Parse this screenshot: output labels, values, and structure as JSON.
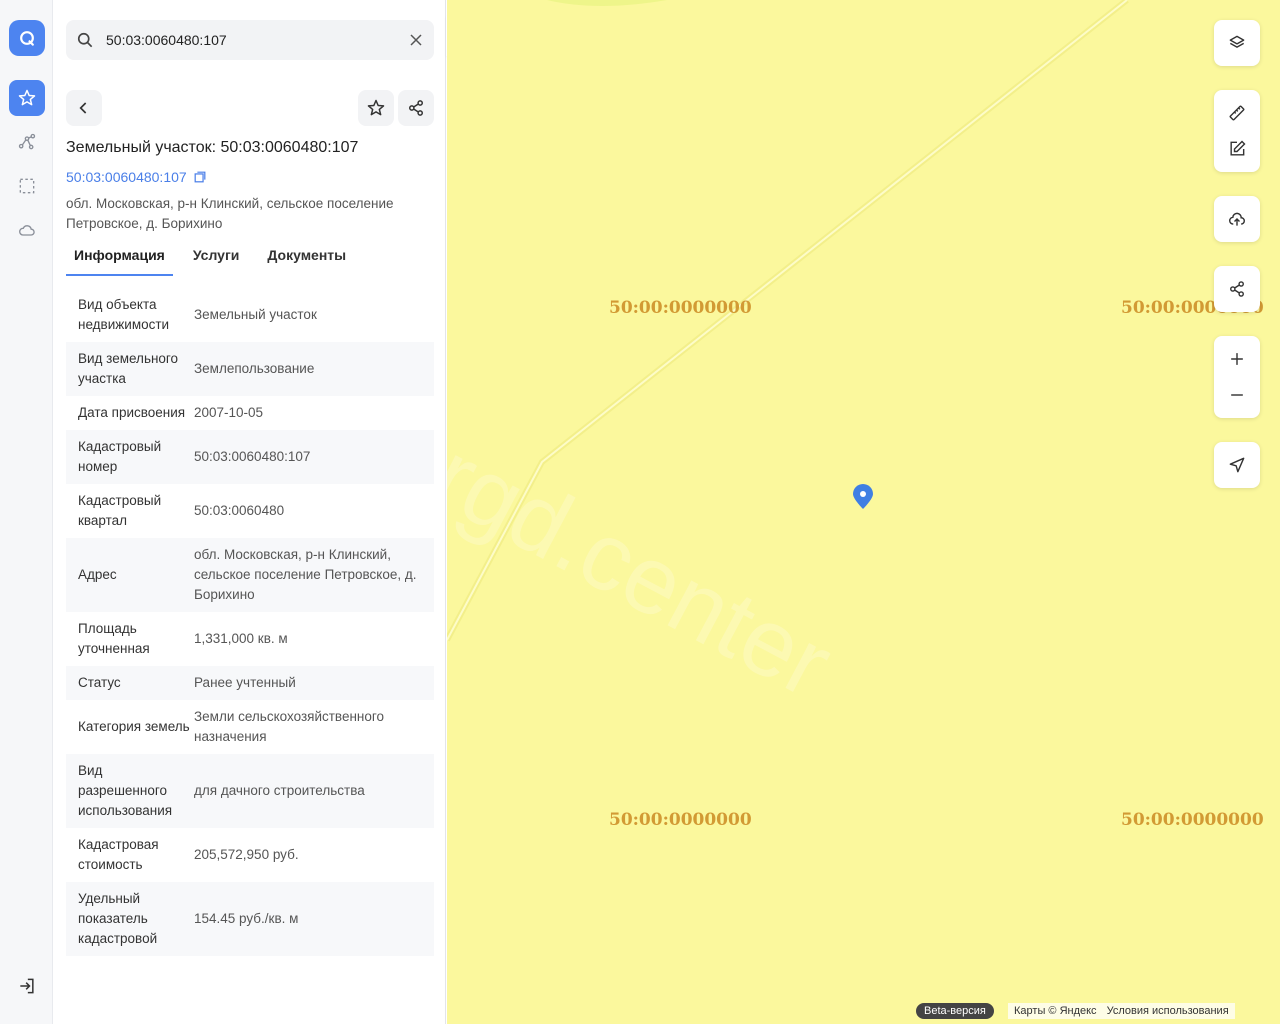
{
  "search": {
    "value": "50:03:0060480:107"
  },
  "panel": {
    "title": "Земельный участок: 50:03:0060480:107",
    "cadastral_link": "50:03:0060480:107",
    "address_line1": "обл. Московская, р-н Клинский, сельское поселение",
    "address_line2": "Петровское, д. Борихино",
    "tabs": [
      {
        "label": "Информация",
        "active": true
      },
      {
        "label": "Услуги",
        "active": false
      },
      {
        "label": "Документы",
        "active": false
      }
    ],
    "rows": [
      {
        "key": "Вид объекта недвижимости",
        "value": "Земельный участок"
      },
      {
        "key": "Вид земельного участка",
        "value": "Землепользование"
      },
      {
        "key": "Дата присвоения",
        "value": "2007-10-05"
      },
      {
        "key": "Кадастровый номер",
        "value": "50:03:0060480:107"
      },
      {
        "key": "Кадастровый квартал",
        "value": "50:03:0060480"
      },
      {
        "key": "Адрес",
        "value": "обл. Московская, р-н Клинский, сельское поселение Петровское, д. Борихино"
      },
      {
        "key": "Площадь уточненная",
        "value": "1,331,000 кв. м"
      },
      {
        "key": "Статус",
        "value": "Ранее учтенный"
      },
      {
        "key": "Категория земель",
        "value": "Земли сельскохозяйственного назначения"
      },
      {
        "key": "Вид разрешенного использования",
        "value": "для дачного строительства"
      },
      {
        "key": "Кадастровая стоимость",
        "value": "205,572,950 руб."
      },
      {
        "key": "Удельный показатель кадастровой",
        "value": "154.45 руб./кв. м"
      }
    ]
  },
  "map": {
    "labels": [
      "50:00:0000000",
      "50:00:0000000",
      "50:00:0000000",
      "50:00:0000000"
    ],
    "watermark": "rgd.center",
    "beta": "Beta-версия",
    "copyright": "Карты © Яндекс",
    "terms": "Условия использования"
  },
  "colors": {
    "accent": "#4d84f0",
    "map_fill": "#fbf89d",
    "label": "#d29a34"
  }
}
